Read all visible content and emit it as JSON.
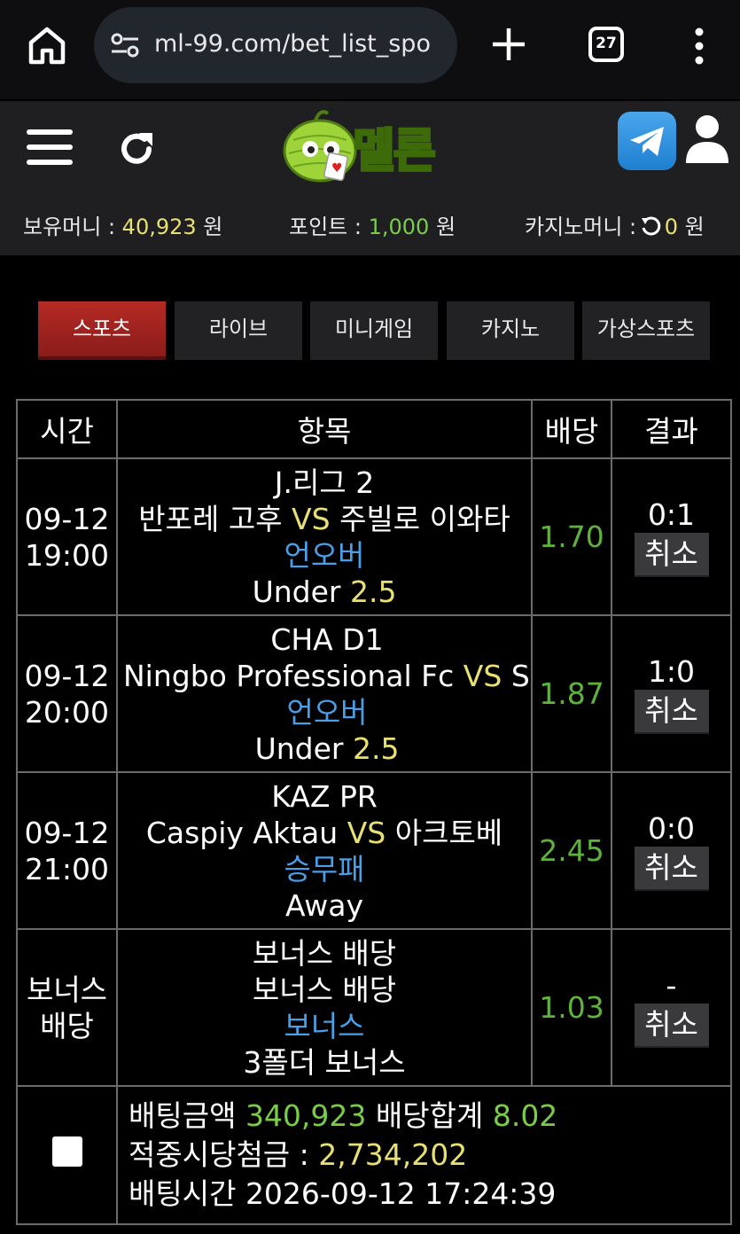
{
  "browser": {
    "url": "ml-99.com/bet_list_spo",
    "tab_count": "27"
  },
  "header": {
    "logo_text": "멜론",
    "balance": {
      "label": "보유머니 : ",
      "value": "40,923",
      "unit": " 원"
    },
    "points": {
      "label": "포인트 : ",
      "value": "1,000",
      "unit": " 원"
    },
    "casino": {
      "label": "카지노머니 : ",
      "value": "0",
      "unit": " 원"
    }
  },
  "nav": {
    "tabs": [
      {
        "label": "스포츠",
        "active": true
      },
      {
        "label": "라이브",
        "active": false
      },
      {
        "label": "미니게임",
        "active": false
      },
      {
        "label": "카지노",
        "active": false
      },
      {
        "label": "가상스포츠",
        "active": false
      }
    ]
  },
  "table": {
    "headers": {
      "time": "시간",
      "item": "항목",
      "odds": "배당",
      "result": "결과"
    },
    "rows": [
      {
        "date": "09-12",
        "time": "19:00",
        "league": "J.리그 2",
        "home": "반포레 고후",
        "vs": "VS",
        "away": "주빌로 이와타",
        "market": "언오버",
        "pick": "Under",
        "pick_value": "2.5",
        "odds": "1.70",
        "score": "0:1",
        "cancel": "취소"
      },
      {
        "date": "09-12",
        "time": "20:00",
        "league": "CHA D1",
        "home": "Ningbo Professional Fc",
        "vs": "VS",
        "away": "S",
        "market": "언오버",
        "pick": "Under",
        "pick_value": "2.5",
        "odds": "1.87",
        "score": "1:0",
        "cancel": "취소"
      },
      {
        "date": "09-12",
        "time": "21:00",
        "league": "KAZ PR",
        "home": "Caspiy Aktau",
        "vs": "VS",
        "away": "아크토베",
        "market": "승무패",
        "pick": "Away",
        "pick_value": "",
        "odds": "2.45",
        "score": "0:0",
        "cancel": "취소"
      },
      {
        "date": "보너스",
        "time": "배당",
        "league": "보너스 배당",
        "home": "보너스 배당",
        "vs": "",
        "away": "",
        "market": "보너스",
        "pick": "3폴더 보너스",
        "pick_value": "",
        "odds": "1.03",
        "score": "-",
        "cancel": "취소"
      }
    ],
    "summary": {
      "bet_amount_label": "배팅금액 ",
      "bet_amount": "340,923",
      "odds_total_label": " 배당합계 ",
      "odds_total": "8.02",
      "payout_label": "적중시당첨금 : ",
      "payout": "2,734,202",
      "bet_time_label": "배팅시간 ",
      "bet_time": "2026-09-12 17:24:39"
    }
  }
}
